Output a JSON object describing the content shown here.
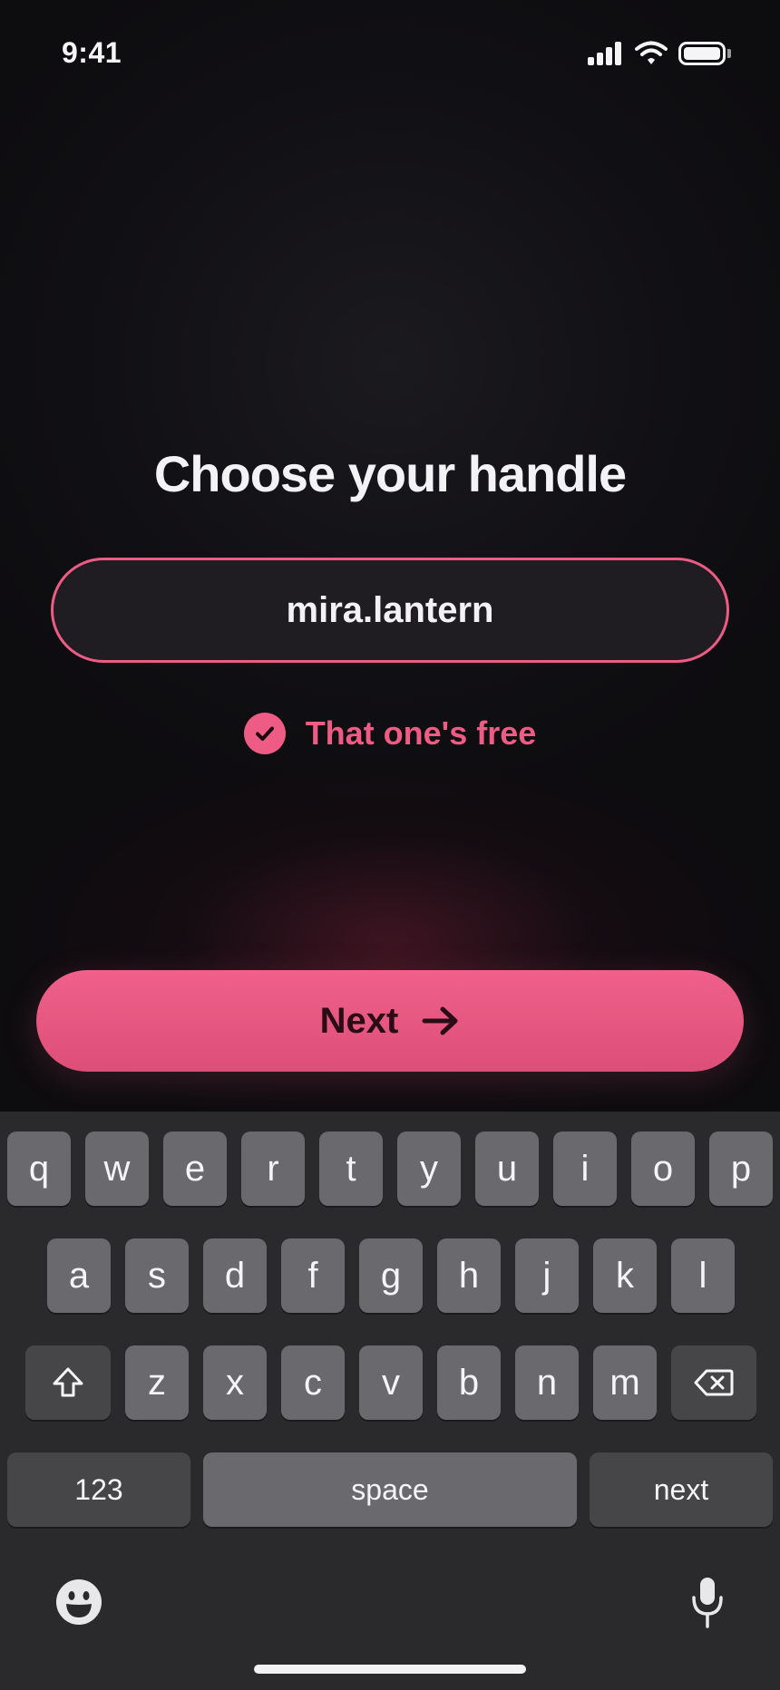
{
  "status_bar": {
    "time": "9:41"
  },
  "screen": {
    "title": "Choose your handle",
    "handle_input": {
      "value": "mira.lantern"
    },
    "availability": {
      "text": "That one's free",
      "icon": "check-circle-icon"
    },
    "next_button": {
      "label": "Next",
      "icon": "arrow-right-icon"
    }
  },
  "colors": {
    "accent": "#ee5c85",
    "background": "#0d0c0f",
    "keyboard": "#2a2a2d"
  },
  "keyboard": {
    "row1": [
      "q",
      "w",
      "e",
      "r",
      "t",
      "y",
      "u",
      "i",
      "o",
      "p"
    ],
    "row2": [
      "a",
      "s",
      "d",
      "f",
      "g",
      "h",
      "j",
      "k",
      "l"
    ],
    "row3": [
      "z",
      "x",
      "c",
      "v",
      "b",
      "n",
      "m"
    ],
    "shift_icon": "shift-icon",
    "delete_icon": "delete-icon",
    "numbers_label": "123",
    "space_label": "space",
    "return_label": "next",
    "emoji_icon": "emoji-icon",
    "mic_icon": "microphone-icon"
  }
}
